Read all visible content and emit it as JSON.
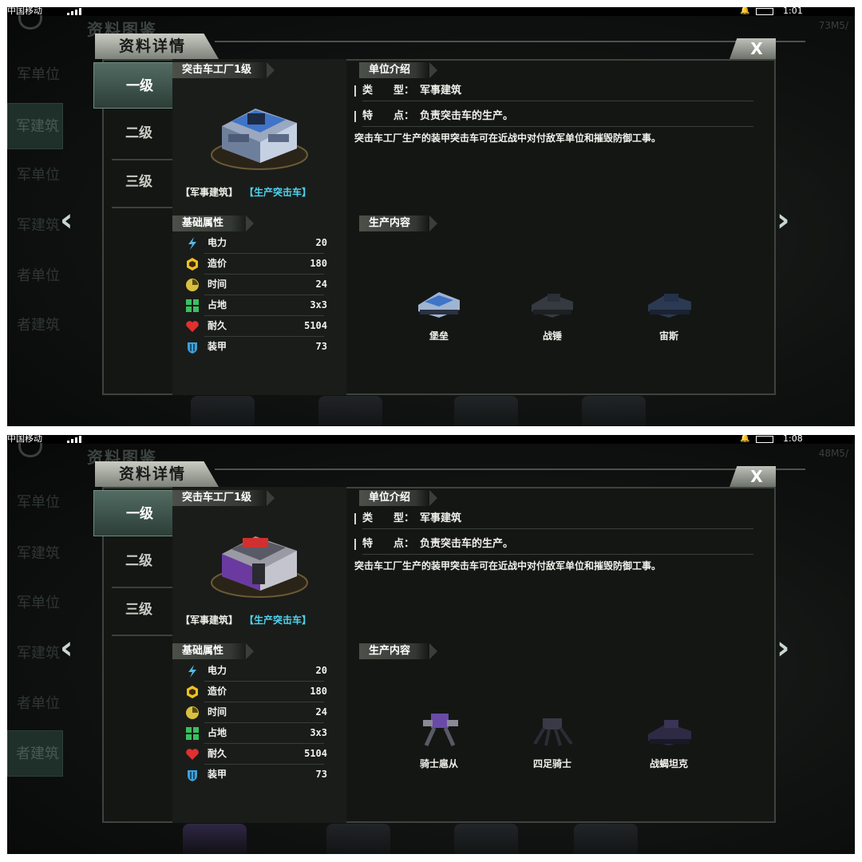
{
  "screens": [
    {
      "status": {
        "carrier": "中国移动",
        "time": "1:01"
      },
      "background": {
        "title": "资料图鉴",
        "memory": "73M5/",
        "categories": [
          "军单位",
          "军建筑",
          "军单位",
          "军建筑",
          "者单位",
          "者建筑"
        ]
      },
      "dialog": {
        "title": "资料详情",
        "close_label": "X",
        "tabs": [
          "一级",
          "二级",
          "三级"
        ],
        "building_name": "突击车工厂1级",
        "tag_type": "【军事建筑】",
        "tag_produce": "【生产突击车】",
        "attributes_header": "基础属性",
        "attributes": [
          {
            "icon": "lightning-icon",
            "name": "电力",
            "value": "20"
          },
          {
            "icon": "cube-icon",
            "name": "造价",
            "value": "180"
          },
          {
            "icon": "clock-icon",
            "name": "时间",
            "value": "24"
          },
          {
            "icon": "area-icon",
            "name": "占地",
            "value": "3x3"
          },
          {
            "icon": "heart-icon",
            "name": "耐久",
            "value": "5104"
          },
          {
            "icon": "shield-icon",
            "name": "装甲",
            "value": "73"
          }
        ],
        "intro_header": "单位介绍",
        "type_label": "类　　型：",
        "type_value": "军事建筑",
        "feature_label": "特　　点：",
        "feature_value": "负责突击车的生产。",
        "description": "突击车工厂生产的装甲突击车可在近战中对付敌军单位和摧毁防御工事。",
        "production_header": "生产内容",
        "units": [
          {
            "name": "堡垒",
            "locked": false
          },
          {
            "name": "战锤",
            "locked": true
          },
          {
            "name": "宙斯",
            "locked": true
          }
        ]
      }
    },
    {
      "status": {
        "carrier": "中国移动",
        "time": "1:08"
      },
      "background": {
        "title": "资料图鉴",
        "memory": "48M5/",
        "categories": [
          "军单位",
          "军建筑",
          "军单位",
          "军建筑",
          "者单位",
          "者建筑"
        ]
      },
      "dialog": {
        "title": "资料详情",
        "close_label": "X",
        "tabs": [
          "一级",
          "二级",
          "三级"
        ],
        "building_name": "突击车工厂1级",
        "tag_type": "【军事建筑】",
        "tag_produce": "【生产突击车】",
        "attributes_header": "基础属性",
        "attributes": [
          {
            "icon": "lightning-icon",
            "name": "电力",
            "value": "20"
          },
          {
            "icon": "cube-icon",
            "name": "造价",
            "value": "180"
          },
          {
            "icon": "clock-icon",
            "name": "时间",
            "value": "24"
          },
          {
            "icon": "area-icon",
            "name": "占地",
            "value": "3x3"
          },
          {
            "icon": "heart-icon",
            "name": "耐久",
            "value": "5104"
          },
          {
            "icon": "shield-icon",
            "name": "装甲",
            "value": "73"
          }
        ],
        "intro_header": "单位介绍",
        "type_label": "类　　型：",
        "type_value": "军事建筑",
        "feature_label": "特　　点：",
        "feature_value": "负责突击车的生产。",
        "description": "突击车工厂生产的装甲突击车可在近战中对付敌军单位和摧毁防御工事。",
        "production_header": "生产内容",
        "units": [
          {
            "name": "骑士扈从",
            "locked": false
          },
          {
            "name": "四足骑士",
            "locked": true
          },
          {
            "name": "战蝎坦克",
            "locked": true
          }
        ]
      }
    }
  ],
  "colors": {
    "accent_cyan": "#4fd3ee",
    "panel": "#141614",
    "tab_selected": "#3f564e"
  }
}
